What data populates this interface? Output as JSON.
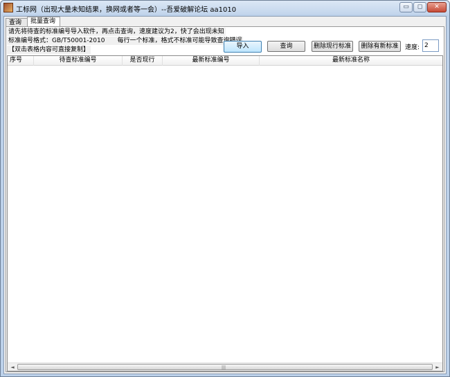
{
  "window": {
    "title": "工标网（出现大量未知结果，换网或者等一会）--吾爱破解论坛 aa1010",
    "controls": {
      "minimize": "▭",
      "maximize": "◻",
      "close": "✕"
    },
    "icon": "app-icon"
  },
  "tabs": [
    {
      "label": "查询"
    },
    {
      "label": "批量查询"
    }
  ],
  "hints": {
    "line1": "请先将待查的标准编号导入软件，再点击查询，速度建议为2，快了会出现未知",
    "line2": "标准编号格式：GB/T50001-2010　　每行一个标准，格式不标准可能导致查询错误",
    "line3": "【双击表格内容可直接复制】"
  },
  "toolbar": {
    "import_label": "导入",
    "query_label": "查询",
    "delete_current_label": "删除现行标准",
    "delete_newer_label": "删除有新标准",
    "speed_label": "速度:",
    "speed_value": "2"
  },
  "table": {
    "columns": [
      "序号",
      "待查标准编号",
      "是否现行",
      "最新标准编号",
      "最新标准名称"
    ],
    "rows": []
  },
  "scrollbar": {
    "left_arrow": "◄",
    "right_arrow": "►",
    "grip": "|||"
  }
}
